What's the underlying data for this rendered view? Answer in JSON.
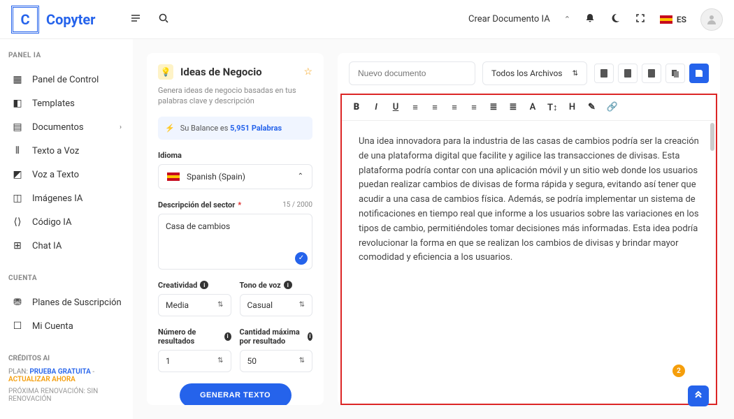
{
  "brand": {
    "letter": "C",
    "name": "Copyter"
  },
  "header": {
    "create_doc": "Crear Documento IA",
    "lang_code": "ES"
  },
  "sidebar": {
    "section1_title": "PANEL IA",
    "items1": [
      {
        "icon": "▦",
        "label": "Panel de Control"
      },
      {
        "icon": "◧",
        "label": "Templates"
      },
      {
        "icon": "▤",
        "label": "Documentos",
        "chevron": true
      },
      {
        "icon": "⦀",
        "label": "Texto a Voz"
      },
      {
        "icon": "◩",
        "label": "Voz a Texto"
      },
      {
        "icon": "◫",
        "label": "Imágenes IA"
      },
      {
        "icon": "⟨⟩",
        "label": "Código IA"
      },
      {
        "icon": "⊞",
        "label": "Chat IA"
      }
    ],
    "section2_title": "CUENTA",
    "items2": [
      {
        "icon": "⛃",
        "label": "Planes de Suscripción"
      },
      {
        "icon": "☐",
        "label": "Mi Cuenta"
      }
    ],
    "credits_title": "CRÉDITOS AI",
    "plan_prefix": "PLAN: ",
    "plan_name": "PRUEBA GRATUITA",
    "plan_sep": " - ",
    "upgrade": "ACTUALIZAR AHORA",
    "renewal": "PRÓXIMA RENOVACIÓN: SIN RENOVACIÓN"
  },
  "form": {
    "title": "Ideas de Negocio",
    "desc": "Genera ideas de negocio basadas en tus palabras clave y descripción",
    "balance_prefix": "Su Balance es ",
    "balance_value": "5,951 Palabras",
    "lang_label": "Idioma",
    "lang_value": "Spanish (Spain)",
    "sector_label": "Descripción del sector",
    "sector_count": "15 / 2000",
    "sector_value": "Casa de cambios",
    "creativity_label": "Creatividad",
    "creativity_value": "Media",
    "tone_label": "Tono de voz",
    "tone_value": "Casual",
    "results_label": "Número de resultados",
    "results_value": "1",
    "maxwords_label": "Cantidad máxima por resultado",
    "maxwords_value": "50",
    "generate": "GENERAR TEXTO"
  },
  "editor": {
    "doc_placeholder": "Nuevo documento",
    "archive_label": "Todos los Archivos",
    "content": "Una idea innovadora para la industria de las casas de cambios podría ser la creación de una plataforma digital que facilite y agilice las transacciones de divisas. Esta plataforma podría contar con una aplicación móvil y un sitio web donde los usuarios puedan realizar cambios de divisas de forma rápida y segura, evitando así tener que acudir a una casa de cambios física. Además, se podría implementar un sistema de notificaciones en tiempo real que informe a los usuarios sobre las variaciones en los tipos de cambio, permitiéndoles tomar decisiones más informadas. Esta idea podría revolucionar la forma en que se realizan los cambios de divisas y brindar mayor comodidad y eficiencia a los usuarios."
  },
  "float": {
    "badge": "2"
  }
}
